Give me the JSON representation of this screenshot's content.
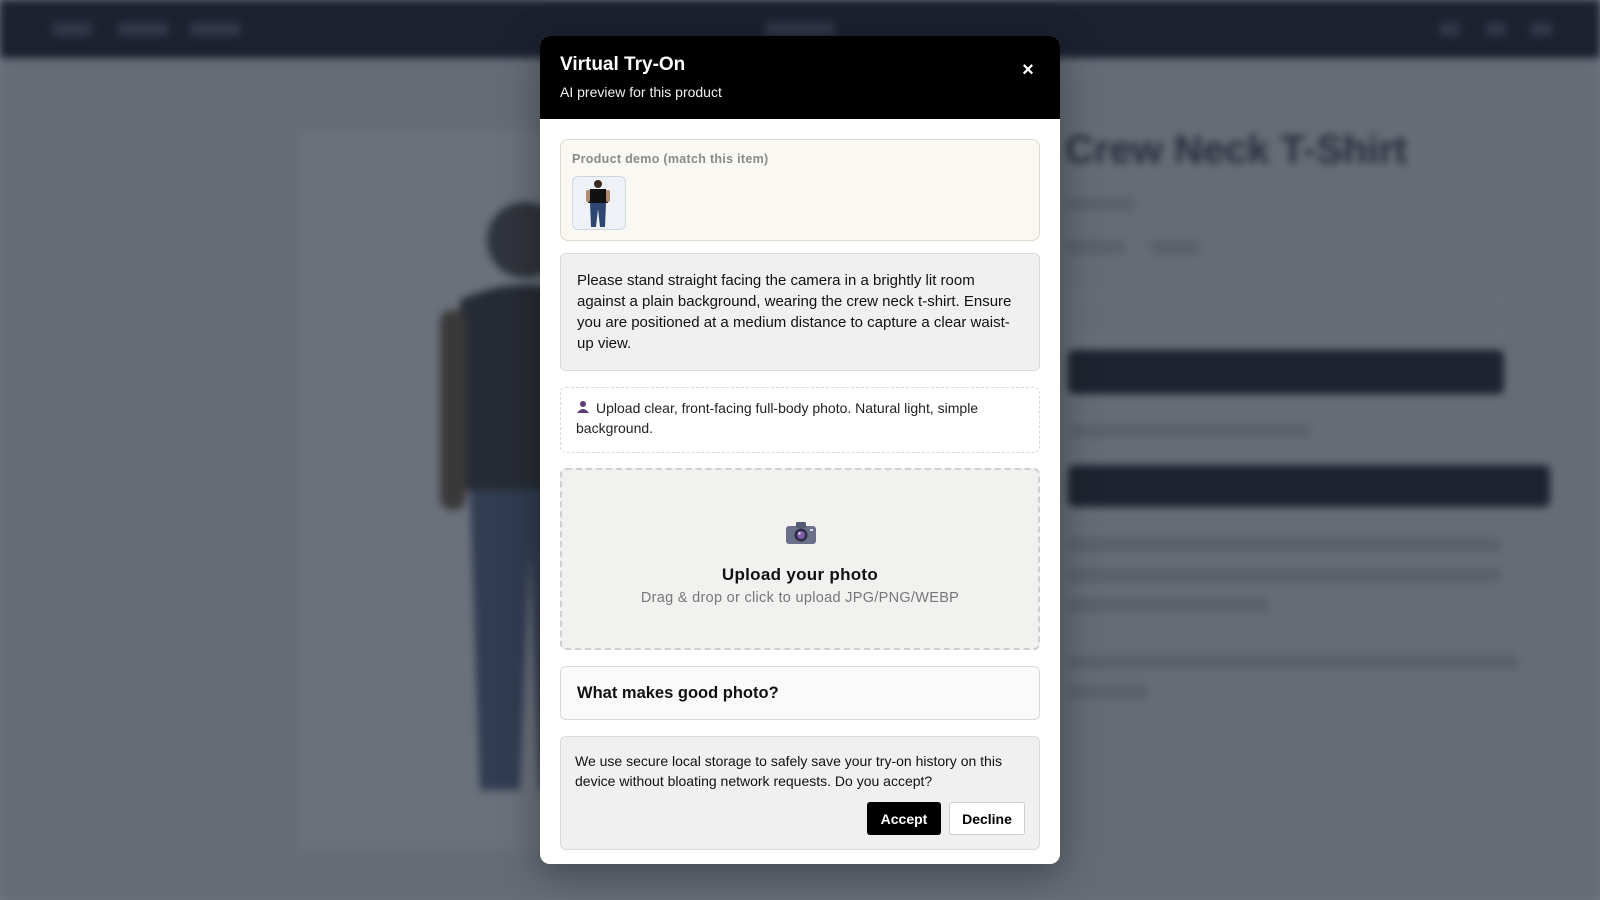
{
  "background": {
    "product_title": "Crew Neck T-Shirt"
  },
  "modal": {
    "title": "Virtual Try-On",
    "subtitle": "AI preview for this product",
    "close_label": "×"
  },
  "demo": {
    "label": "Product demo (match this item)"
  },
  "instruction": {
    "text": "Please stand straight facing the camera in a brightly lit room against a plain background, wearing the crew neck t-shirt. Ensure you are positioned at a medium distance to capture a clear waist-up view."
  },
  "tip": {
    "text": "Upload clear, front-facing full-body photo. Natural light, simple background."
  },
  "upload": {
    "title": "Upload your photo",
    "subtitle": "Drag & drop or click to upload JPG/PNG/WEBP"
  },
  "faq": {
    "title": "What makes good photo?"
  },
  "consent": {
    "text": "We use secure local storage to safely save your try-on history on this device without bloating network requests. Do you accept?",
    "accept_label": "Accept",
    "decline_label": "Decline"
  },
  "colors": {
    "header_bg": "#000000",
    "accent": "#5a3d7a"
  }
}
